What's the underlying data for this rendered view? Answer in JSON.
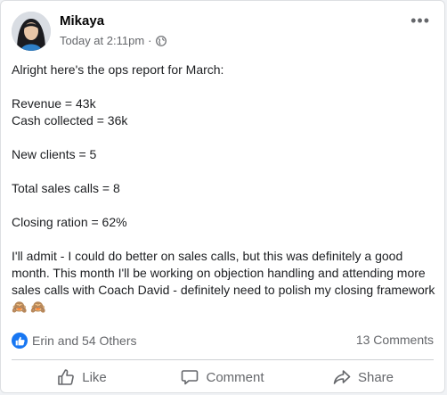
{
  "post": {
    "author": "Mikaya",
    "timestamp": "Today at 2:11pm",
    "separator": "·",
    "more_label": "•••",
    "body": {
      "intro": "Alright here's the ops report for March:",
      "revenue": "Revenue = 43k",
      "cash": "Cash collected = 36k",
      "new_clients": "New clients = 5",
      "sales_calls": "Total sales calls = 8",
      "closing": "Closing ration = 62%",
      "closing_paragraph": "I'll admit - I could do better on sales calls, but this was definitely a good month. This month I'll be working on objection handling and attending more sales calls with Coach David - definitely need to polish my closing framework",
      "emoji": "🙈 🙈"
    },
    "reactions_text": "Erin and 54 Others",
    "comments_text": "13 Comments"
  },
  "actions": {
    "like": "Like",
    "comment": "Comment",
    "share": "Share"
  },
  "colors": {
    "accent": "#1877f2",
    "muted": "#65676b"
  }
}
